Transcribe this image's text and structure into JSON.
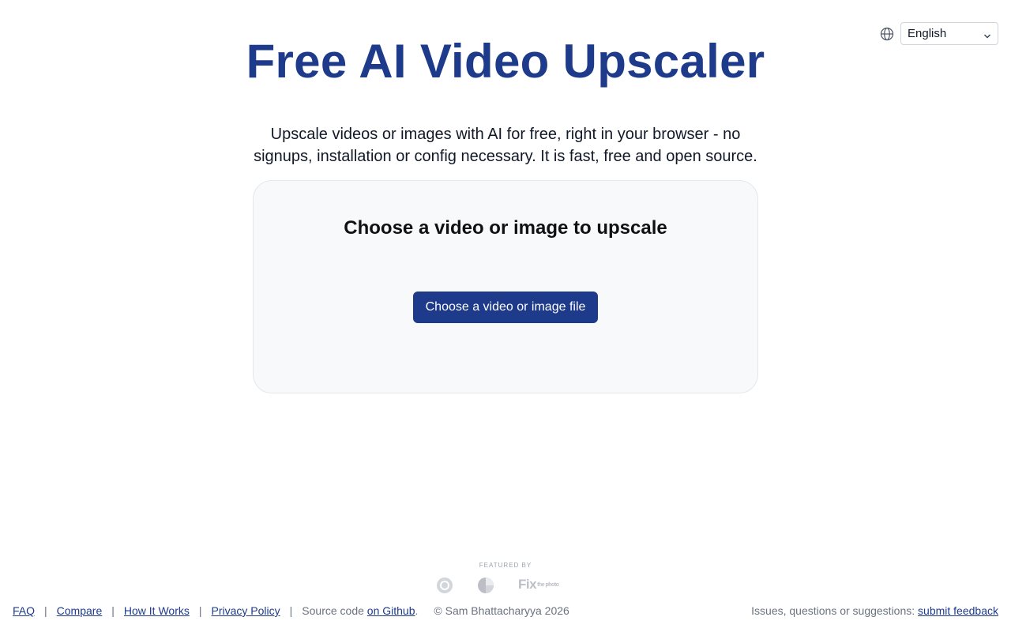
{
  "language": {
    "icon": "globe-icon",
    "selected": "English"
  },
  "header": {
    "title": "Free AI Video Upscaler",
    "subtitle": "Upscale videos or images with AI for free, right in your browser - no signups, installation or config necessary. It is fast, free and open source."
  },
  "upload": {
    "heading": "Choose a video or image to upscale",
    "button_label": "Choose a video or image file"
  },
  "featured": {
    "label": "FEATURED BY",
    "logos": [
      "circle-logo-icon",
      "pie-logo-icon",
      "fix-the-photo-logo"
    ],
    "fix_logo_text": "Fix",
    "fix_logo_small": "the photo"
  },
  "footer": {
    "links": [
      "FAQ",
      "Compare",
      "How It Works",
      "Privacy Policy"
    ],
    "source_prefix": "Source code ",
    "source_link": "on Github",
    "source_suffix": ".",
    "copyright": "© Sam Bhattacharyya 2026",
    "feedback_prefix": "Issues, questions or suggestions: ",
    "feedback_link": "submit feedback"
  },
  "colors": {
    "accent": "#1e3a8a",
    "card_bg": "#f8f9fa"
  }
}
